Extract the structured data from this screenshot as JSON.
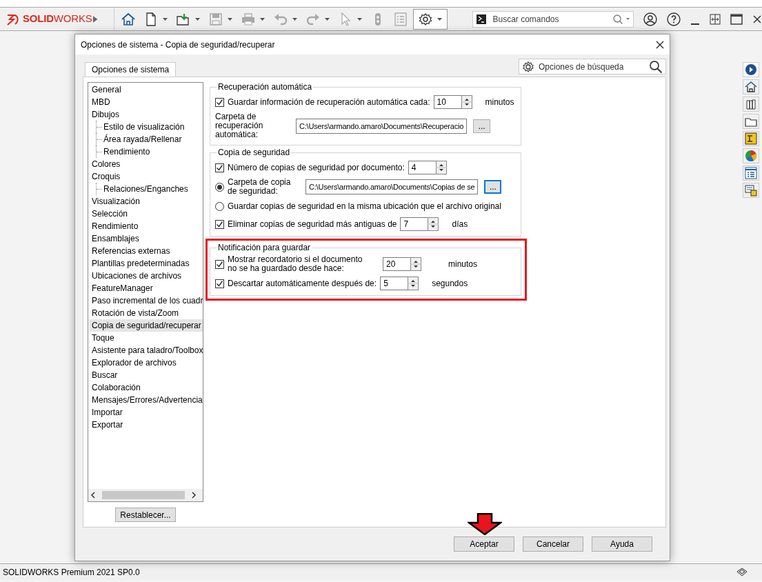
{
  "app": {
    "logo": "**SOLID**WORKS",
    "search": {
      "placeholder": "Buscar comandos"
    }
  },
  "toolbar": [
    {
      "kind": "home",
      "disabled": false,
      "dropdown": false,
      "pressed": false
    },
    {
      "kind": "new",
      "disabled": false,
      "dropdown": true,
      "pressed": false
    },
    {
      "kind": "open",
      "disabled": false,
      "dropdown": true,
      "pressed": false
    },
    {
      "kind": "save",
      "disabled": true,
      "dropdown": true,
      "pressed": false
    },
    {
      "kind": "print",
      "disabled": true,
      "dropdown": true,
      "pressed": false
    },
    {
      "kind": "undo",
      "disabled": true,
      "dropdown": true,
      "pressed": false
    },
    {
      "kind": "redo",
      "disabled": true,
      "dropdown": true,
      "pressed": false
    },
    {
      "kind": "select",
      "disabled": true,
      "dropdown": true,
      "pressed": false
    },
    {
      "kind": "rebuild",
      "disabled": true,
      "dropdown": false,
      "pressed": false
    },
    {
      "kind": "properties",
      "disabled": true,
      "dropdown": false,
      "pressed": false
    },
    {
      "kind": "options",
      "disabled": false,
      "dropdown": true,
      "pressed": true
    }
  ],
  "dialog": {
    "title": "Opciones de sistema - Copia de seguridad/recuperar",
    "tabs": [
      {
        "label": "Opciones de sistema",
        "selected": true
      }
    ],
    "search": {
      "placeholder": "Opciones de búsqueda"
    },
    "tree": [
      {
        "label": "General",
        "selected": false
      },
      {
        "label": "MBD",
        "selected": false
      },
      {
        "label": "Dibujos",
        "selected": false,
        "children": [
          {
            "label": "Estilo de visualización",
            "selected": false
          },
          {
            "label": "Área rayada/Rellenar",
            "selected": false
          },
          {
            "label": "Rendimiento",
            "selected": false
          }
        ]
      },
      {
        "label": "Colores",
        "selected": false
      },
      {
        "label": "Croquis",
        "selected": false,
        "children": [
          {
            "label": "Relaciones/Enganches",
            "selected": false
          }
        ]
      },
      {
        "label": "Visualización",
        "selected": false
      },
      {
        "label": "Selección",
        "selected": false
      },
      {
        "label": "Rendimiento",
        "selected": false
      },
      {
        "label": "Ensamblajes",
        "selected": false
      },
      {
        "label": "Referencias externas",
        "selected": false
      },
      {
        "label": "Plantillas predeterminadas",
        "selected": false
      },
      {
        "label": "Ubicaciones de archivos",
        "selected": false
      },
      {
        "label": "FeatureManager",
        "selected": false
      },
      {
        "label": "Paso incremental de los cuadr",
        "selected": false
      },
      {
        "label": "Rotación de vista/Zoom",
        "selected": false
      },
      {
        "label": "Copia de seguridad/recuperar",
        "selected": true
      },
      {
        "label": "Toque",
        "selected": false
      },
      {
        "label": "Asistente para taladro/Toolbox",
        "selected": false
      },
      {
        "label": "Explorador de archivos",
        "selected": false
      },
      {
        "label": "Buscar",
        "selected": false
      },
      {
        "label": "Colaboración",
        "selected": false
      },
      {
        "label": "Mensajes/Errores/Advertencia",
        "selected": false
      },
      {
        "label": "Importar",
        "selected": false
      },
      {
        "label": "Exportar",
        "selected": false
      }
    ],
    "reset_button": "Restablecer...",
    "sections": [
      {
        "title": "Recuperación automática",
        "highlighted": false,
        "rows": [
          {
            "kind": "checkbox-spin",
            "checked": true,
            "label": "Guardar información de recuperación automática cada:",
            "value": "10",
            "unit": "minutos"
          },
          {
            "kind": "path",
            "label": "Carpeta de recuperación automática:",
            "value": "C:\\Users\\armando.amaro\\Documents\\Recuperacio",
            "button": "...",
            "focused": false
          }
        ]
      },
      {
        "title": "Copia de seguridad",
        "highlighted": false,
        "rows": [
          {
            "kind": "checkbox-spin",
            "checked": true,
            "label": "Número de copias de seguridad por documento:",
            "value": "4"
          },
          {
            "kind": "radio-path",
            "selected": true,
            "label": "Carpeta de copia de seguridad:",
            "value": "C:\\Users\\armando.amaro\\Documents\\Copias de se",
            "button": "...",
            "focused": true
          },
          {
            "kind": "radio",
            "selected": false,
            "label": "Guardar copias de seguridad en la misma ubicación que el archivo original"
          },
          {
            "kind": "checkbox-spin",
            "checked": true,
            "label": "Eliminar copias de seguridad más antiguas de",
            "value": "7",
            "unit": "días"
          }
        ]
      },
      {
        "title": "Notificación para guardar",
        "highlighted": true,
        "rows": [
          {
            "kind": "checkbox-spin",
            "checked": true,
            "label": "Mostrar recordatorio si el documento no se ha guardado desde hace:",
            "value": "20",
            "unit": "minutos"
          },
          {
            "kind": "checkbox-spin",
            "checked": true,
            "label": "Descartar automáticamente después de:",
            "value": "5",
            "unit": "segundos"
          }
        ]
      }
    ],
    "buttons": [
      {
        "label": "Aceptar",
        "pointed": true
      },
      {
        "label": "Cancelar",
        "pointed": false
      },
      {
        "label": "Ayuda",
        "pointed": false
      }
    ]
  },
  "status_bar": {
    "text": "SOLIDWORKS Premium 2021 SP0.0"
  }
}
